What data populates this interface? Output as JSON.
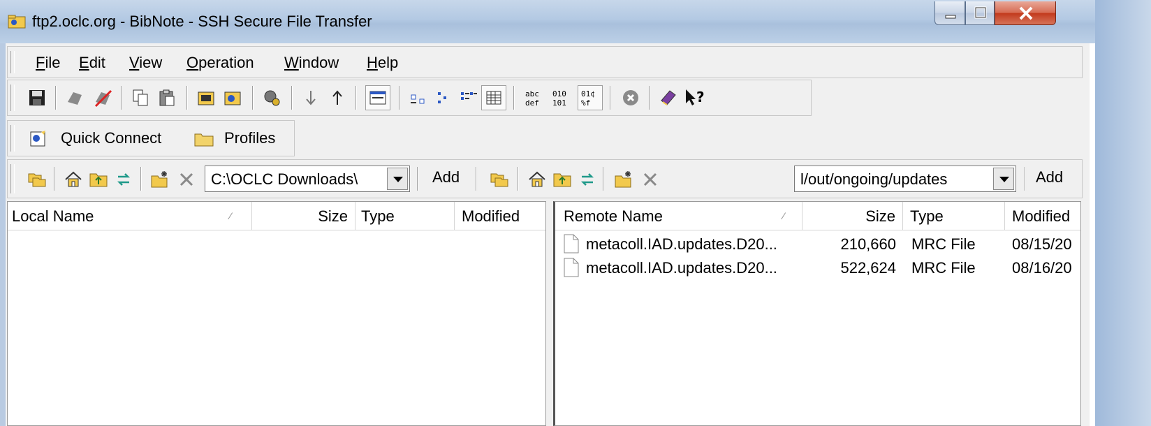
{
  "window": {
    "title": "ftp2.oclc.org - BibNote - SSH Secure File Transfer",
    "controls": {
      "minimize": "–",
      "maximize": "□",
      "close": "X"
    }
  },
  "menu": {
    "items": [
      {
        "accel": "F",
        "rest": "ile"
      },
      {
        "accel": "E",
        "rest": "dit"
      },
      {
        "accel": "V",
        "rest": "iew"
      },
      {
        "accel": "O",
        "rest": "peration"
      },
      {
        "accel": "W",
        "rest": "indow"
      },
      {
        "accel": "H",
        "rest": "elp"
      }
    ]
  },
  "toolbar": {
    "quick_connect": "Quick Connect",
    "profiles": "Profiles",
    "text_icons": {
      "ascii": "abc\ndef",
      "binary": "010\n101",
      "auto": "01¢\n%f"
    }
  },
  "local": {
    "path": "C:\\OCLC Downloads\\",
    "add_label": "Add",
    "columns": {
      "name": "Local Name",
      "size": "Size",
      "type": "Type",
      "modified": "Modified"
    },
    "files": []
  },
  "remote": {
    "path": "l/out/ongoing/updates",
    "add_label": "Add",
    "columns": {
      "name": "Remote Name",
      "size": "Size",
      "type": "Type",
      "modified": "Modified"
    },
    "files": [
      {
        "name": "metacoll.IAD.updates.D20...",
        "size": "210,660",
        "type": "MRC File",
        "modified": "08/15/20"
      },
      {
        "name": "metacoll.IAD.updates.D20...",
        "size": "522,624",
        "type": "MRC File",
        "modified": "08/16/20"
      }
    ]
  }
}
